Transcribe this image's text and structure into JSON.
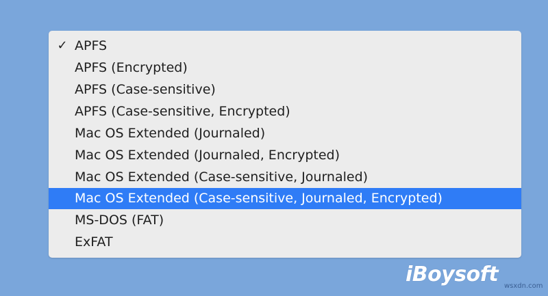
{
  "colors": {
    "background": "#7aa6db",
    "menu_background": "#ececec",
    "selection": "#2f7cf6",
    "text": "#1e1e1e",
    "selected_text": "#ffffff"
  },
  "menu": {
    "checked_index": 0,
    "highlighted_index": 7,
    "checkmark_glyph": "✓",
    "items": [
      {
        "label": "APFS"
      },
      {
        "label": "APFS (Encrypted)"
      },
      {
        "label": "APFS (Case-sensitive)"
      },
      {
        "label": "APFS (Case-sensitive, Encrypted)"
      },
      {
        "label": "Mac OS Extended (Journaled)"
      },
      {
        "label": "Mac OS Extended (Journaled, Encrypted)"
      },
      {
        "label": "Mac OS Extended (Case-sensitive, Journaled)"
      },
      {
        "label": "Mac OS Extended (Case-sensitive, Journaled, Encrypted)"
      },
      {
        "label": "MS-DOS (FAT)"
      },
      {
        "label": "ExFAT"
      }
    ]
  },
  "watermarks": {
    "logo": "iBoysoft",
    "site": "wsxdn.com"
  }
}
